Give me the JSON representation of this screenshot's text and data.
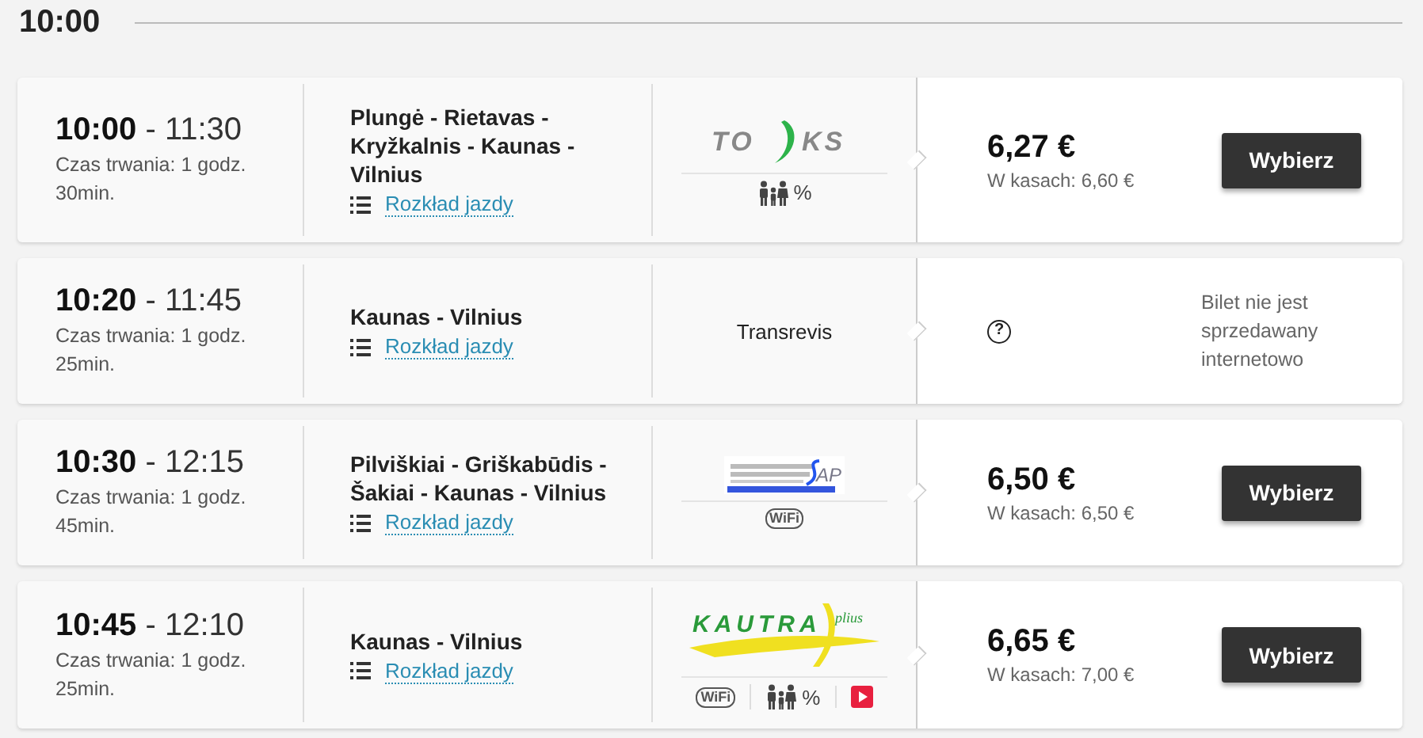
{
  "heading": "10:00",
  "trips": [
    {
      "departure": "10:00",
      "time_separator": "-",
      "arrival": "11:30",
      "duration": "Czas trwania: 1 godz. 30min.",
      "route": "Plungė - Rietavas - Kryžkalnis - Kaunas - Vilnius",
      "timetable_link": "Rozkład jazdy",
      "carrier": {
        "kind": "toks",
        "parts": [
          "TO",
          "KS"
        ]
      },
      "amenities": [
        {
          "kind": "family",
          "label": "%"
        }
      ],
      "sale": {
        "kind": "online",
        "price": "6,27 €",
        "box_office": "W kasach: 6,60 €",
        "button": "Wybierz"
      }
    },
    {
      "departure": "10:20",
      "time_separator": "-",
      "arrival": "11:45",
      "duration": "Czas trwania: 1 godz. 25min.",
      "route": "Kaunas - Vilnius",
      "timetable_link": "Rozkład jazdy",
      "carrier": {
        "kind": "text",
        "name": "Transrevis"
      },
      "sale": {
        "kind": "offline",
        "icon": "?",
        "note": "Bilet nie jest sprzedawany internetowo"
      }
    },
    {
      "departure": "10:30",
      "time_separator": "-",
      "arrival": "12:15",
      "duration": "Czas trwania: 1 godz. 45min.",
      "route": "Pilviškiai - Griškabūdis - Šakiai - Kaunas - Vilnius",
      "timetable_link": "Rozkład jazdy",
      "carrier": {
        "kind": "sap",
        "parts": [
          "AP"
        ]
      },
      "amenities": [
        {
          "kind": "wifi",
          "label": "WiFi"
        }
      ],
      "sale": {
        "kind": "online",
        "price": "6,50 €",
        "box_office": "W kasach: 6,50 €",
        "button": "Wybierz"
      }
    },
    {
      "departure": "10:45",
      "time_separator": "-",
      "arrival": "12:10",
      "duration": "Czas trwania: 1 godz. 25min.",
      "route": "Kaunas - Vilnius",
      "timetable_link": "Rozkład jazdy",
      "carrier": {
        "kind": "kautra",
        "parts": [
          "KAUTRA",
          "plius"
        ]
      },
      "amenities": [
        {
          "kind": "wifi",
          "label": "WiFi"
        },
        {
          "kind": "family",
          "label": "%"
        },
        {
          "kind": "video"
        }
      ],
      "sale": {
        "kind": "online",
        "price": "6,65 €",
        "box_office": "W kasach: 7,00 €",
        "button": "Wybierz"
      }
    }
  ]
}
